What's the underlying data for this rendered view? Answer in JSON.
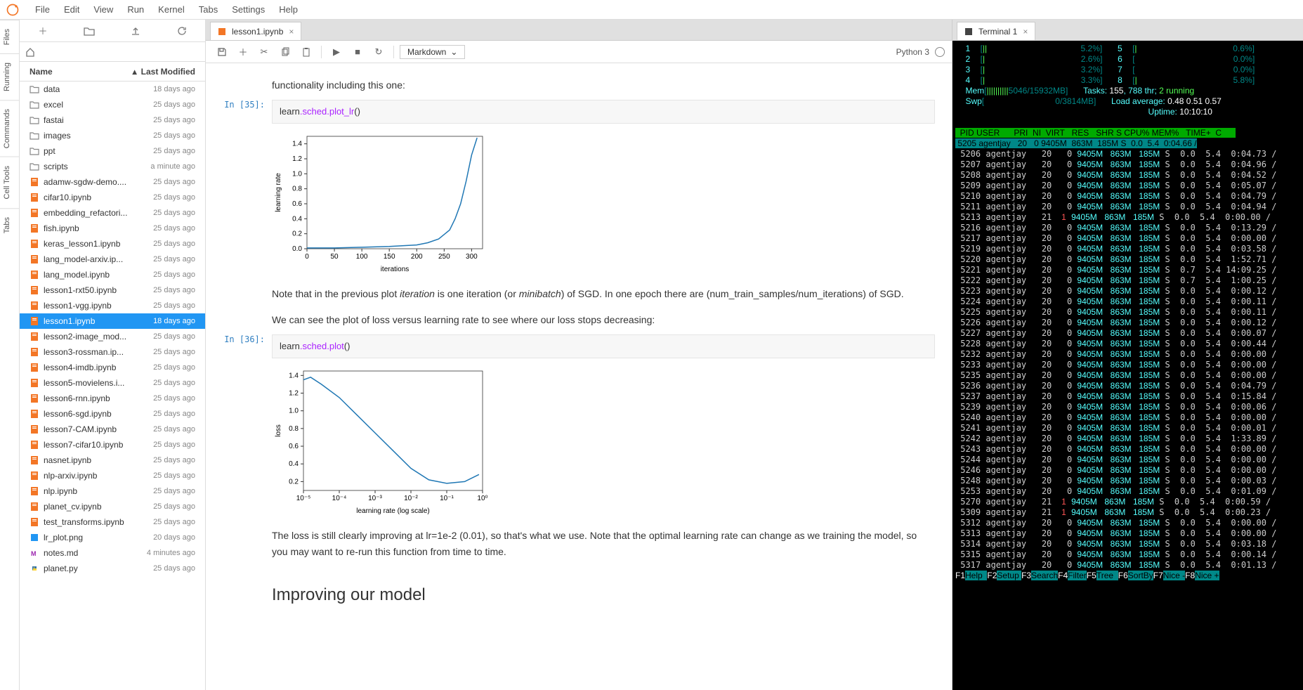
{
  "menubar": [
    "File",
    "Edit",
    "View",
    "Run",
    "Kernel",
    "Tabs",
    "Settings",
    "Help"
  ],
  "rail": [
    "Files",
    "Running",
    "Commands",
    "Cell Tools",
    "Tabs"
  ],
  "fileHeader": {
    "name": "Name",
    "modified": "Last Modified"
  },
  "files": [
    {
      "icon": "folder",
      "name": "data",
      "mod": "18 days ago"
    },
    {
      "icon": "folder",
      "name": "excel",
      "mod": "25 days ago"
    },
    {
      "icon": "folder",
      "name": "fastai",
      "mod": "25 days ago"
    },
    {
      "icon": "folder",
      "name": "images",
      "mod": "25 days ago"
    },
    {
      "icon": "folder",
      "name": "ppt",
      "mod": "25 days ago"
    },
    {
      "icon": "folder",
      "name": "scripts",
      "mod": "a minute ago"
    },
    {
      "icon": "nb",
      "name": "adamw-sgdw-demo....",
      "mod": "25 days ago"
    },
    {
      "icon": "nb",
      "name": "cifar10.ipynb",
      "mod": "25 days ago"
    },
    {
      "icon": "nb",
      "name": "embedding_refactori...",
      "mod": "25 days ago"
    },
    {
      "icon": "nb",
      "name": "fish.ipynb",
      "mod": "25 days ago"
    },
    {
      "icon": "nb",
      "name": "keras_lesson1.ipynb",
      "mod": "25 days ago"
    },
    {
      "icon": "nb",
      "name": "lang_model-arxiv.ip...",
      "mod": "25 days ago"
    },
    {
      "icon": "nb",
      "name": "lang_model.ipynb",
      "mod": "25 days ago"
    },
    {
      "icon": "nb",
      "name": "lesson1-rxt50.ipynb",
      "mod": "25 days ago"
    },
    {
      "icon": "nb",
      "name": "lesson1-vgg.ipynb",
      "mod": "25 days ago"
    },
    {
      "icon": "nb",
      "name": "lesson1.ipynb",
      "mod": "18 days ago",
      "selected": true
    },
    {
      "icon": "nb",
      "name": "lesson2-image_mod...",
      "mod": "25 days ago"
    },
    {
      "icon": "nb",
      "name": "lesson3-rossman.ip...",
      "mod": "25 days ago"
    },
    {
      "icon": "nb",
      "name": "lesson4-imdb.ipynb",
      "mod": "25 days ago"
    },
    {
      "icon": "nb",
      "name": "lesson5-movielens.i...",
      "mod": "25 days ago"
    },
    {
      "icon": "nb",
      "name": "lesson6-rnn.ipynb",
      "mod": "25 days ago"
    },
    {
      "icon": "nb",
      "name": "lesson6-sgd.ipynb",
      "mod": "25 days ago"
    },
    {
      "icon": "nb",
      "name": "lesson7-CAM.ipynb",
      "mod": "25 days ago"
    },
    {
      "icon": "nb",
      "name": "lesson7-cifar10.ipynb",
      "mod": "25 days ago"
    },
    {
      "icon": "nb",
      "name": "nasnet.ipynb",
      "mod": "25 days ago"
    },
    {
      "icon": "nb",
      "name": "nlp-arxiv.ipynb",
      "mod": "25 days ago"
    },
    {
      "icon": "nb",
      "name": "nlp.ipynb",
      "mod": "25 days ago"
    },
    {
      "icon": "nb",
      "name": "planet_cv.ipynb",
      "mod": "25 days ago"
    },
    {
      "icon": "nb",
      "name": "test_transforms.ipynb",
      "mod": "25 days ago"
    },
    {
      "icon": "img",
      "name": "lr_plot.png",
      "mod": "20 days ago"
    },
    {
      "icon": "md",
      "name": "notes.md",
      "mod": "4 minutes ago"
    },
    {
      "icon": "py",
      "name": "planet.py",
      "mod": "25 days ago"
    }
  ],
  "tab": {
    "title": "lesson1.ipynb"
  },
  "celltype": "Markdown",
  "kernel": "Python 3",
  "nb": {
    "md0": "functionality including this one:",
    "prompt1": "In [35]:",
    "code1a": "learn",
    "code1b": ".sched.plot_lr",
    "code1c": "()",
    "md1a": "Note that in the previous plot ",
    "md1_it1": "iteration",
    "md1b": " is one iteration (or ",
    "md1_it2": "minibatch",
    "md1c": ") of SGD. In one epoch there are (num_train_samples/num_iterations) of SGD.",
    "md2": "We can see the plot of loss versus learning rate to see where our loss stops decreasing:",
    "prompt2": "In [36]:",
    "code2a": "learn",
    "code2b": ".sched.plot",
    "code2c": "()",
    "md3": "The loss is still clearly improving at lr=1e-2 (0.01), so that's what we use. Note that the optimal learning rate can change as we training the model, so you may want to re-run this function from time to time.",
    "h2": "Improving our model"
  },
  "chart_data": [
    {
      "type": "line",
      "title": "",
      "xlabel": "iterations",
      "ylabel": "learning rate",
      "xlim": [
        0,
        320
      ],
      "ylim": [
        0,
        1.5
      ],
      "xticks": [
        0,
        50,
        100,
        150,
        200,
        250,
        300
      ],
      "yticks": [
        0.0,
        0.2,
        0.4,
        0.6,
        0.8,
        1.0,
        1.2,
        1.4
      ],
      "x": [
        0,
        50,
        100,
        150,
        200,
        220,
        240,
        260,
        270,
        280,
        290,
        300,
        310
      ],
      "values": [
        0.01,
        0.01,
        0.02,
        0.03,
        0.05,
        0.08,
        0.13,
        0.25,
        0.4,
        0.6,
        0.9,
        1.25,
        1.48
      ]
    },
    {
      "type": "line",
      "title": "",
      "xlabel": "learning rate (log scale)",
      "ylabel": "loss",
      "xlim_log": [
        -5,
        0
      ],
      "ylim": [
        0.1,
        1.45
      ],
      "xticks_labels": [
        "10⁻⁵",
        "10⁻⁴",
        "10⁻³",
        "10⁻²",
        "10⁻¹",
        "10⁰"
      ],
      "yticks": [
        0.2,
        0.4,
        0.6,
        0.8,
        1.0,
        1.2,
        1.4
      ],
      "x_log": [
        -5,
        -4.8,
        -4.5,
        -4,
        -3.5,
        -3,
        -2.5,
        -2,
        -1.5,
        -1,
        -0.5,
        -0.1
      ],
      "values": [
        1.35,
        1.38,
        1.3,
        1.15,
        0.95,
        0.75,
        0.55,
        0.35,
        0.22,
        0.18,
        0.2,
        0.28
      ]
    }
  ],
  "terminal": {
    "tab": "Terminal 1",
    "cpus": [
      {
        "n": "1",
        "bar": "||",
        "pct": "5.2%"
      },
      {
        "n": "2",
        "bar": "|",
        "pct": "2.6%"
      },
      {
        "n": "3",
        "bar": "|",
        "pct": "3.2%"
      },
      {
        "n": "4",
        "bar": "|",
        "pct": "3.3%"
      },
      {
        "n": "5",
        "bar": "|",
        "pct": "0.6%"
      },
      {
        "n": "6",
        "bar": "",
        "pct": "0.0%"
      },
      {
        "n": "7",
        "bar": "",
        "pct": "0.0%"
      },
      {
        "n": "8",
        "bar": "|",
        "pct": "5.8%"
      }
    ],
    "mem": {
      "label": "Mem",
      "used": "5046",
      "total": "15932MB"
    },
    "swp": {
      "label": "Swp",
      "used": "0",
      "total": "3814MB"
    },
    "tasks_label": "Tasks: ",
    "tasks": "155",
    "thr": ", 788 thr; ",
    "running": "2 running",
    "load_label": "Load average: ",
    "load": "0.48 0.51 0.57",
    "uptime_label": "Uptime: ",
    "uptime": "10:10:10",
    "header": "  PID USER      PRI  NI  VIRT   RES   SHR S CPU% MEM%   TIME+  C",
    "procs": [
      {
        "pid": "5205",
        "user": "agentjay",
        "pri": "20",
        "ni": "0",
        "virt": "9405M",
        "res": "863M",
        "shr": "185M",
        "s": "S",
        "cpu": "0.0",
        "mem": "5.4",
        "time": "0:04.66",
        "hl": true
      },
      {
        "pid": "5206",
        "user": "agentjay",
        "pri": "20",
        "ni": "0",
        "virt": "9405M",
        "res": "863M",
        "shr": "185M",
        "s": "S",
        "cpu": "0.0",
        "mem": "5.4",
        "time": "0:04.73"
      },
      {
        "pid": "5207",
        "user": "agentjay",
        "pri": "20",
        "ni": "0",
        "virt": "9405M",
        "res": "863M",
        "shr": "185M",
        "s": "S",
        "cpu": "0.0",
        "mem": "5.4",
        "time": "0:04.96"
      },
      {
        "pid": "5208",
        "user": "agentjay",
        "pri": "20",
        "ni": "0",
        "virt": "9405M",
        "res": "863M",
        "shr": "185M",
        "s": "S",
        "cpu": "0.0",
        "mem": "5.4",
        "time": "0:04.52"
      },
      {
        "pid": "5209",
        "user": "agentjay",
        "pri": "20",
        "ni": "0",
        "virt": "9405M",
        "res": "863M",
        "shr": "185M",
        "s": "S",
        "cpu": "0.0",
        "mem": "5.4",
        "time": "0:05.07"
      },
      {
        "pid": "5210",
        "user": "agentjay",
        "pri": "20",
        "ni": "0",
        "virt": "9405M",
        "res": "863M",
        "shr": "185M",
        "s": "S",
        "cpu": "0.0",
        "mem": "5.4",
        "time": "0:04.79"
      },
      {
        "pid": "5211",
        "user": "agentjay",
        "pri": "20",
        "ni": "0",
        "virt": "9405M",
        "res": "863M",
        "shr": "185M",
        "s": "S",
        "cpu": "0.0",
        "mem": "5.4",
        "time": "0:04.94"
      },
      {
        "pid": "5213",
        "user": "agentjay",
        "pri": "21",
        "ni": "1",
        "virt": "9405M",
        "res": "863M",
        "shr": "185M",
        "s": "S",
        "cpu": "0.0",
        "mem": "5.4",
        "time": "0:00.00",
        "ni_red": true
      },
      {
        "pid": "5216",
        "user": "agentjay",
        "pri": "20",
        "ni": "0",
        "virt": "9405M",
        "res": "863M",
        "shr": "185M",
        "s": "S",
        "cpu": "0.0",
        "mem": "5.4",
        "time": "0:13.29"
      },
      {
        "pid": "5217",
        "user": "agentjay",
        "pri": "20",
        "ni": "0",
        "virt": "9405M",
        "res": "863M",
        "shr": "185M",
        "s": "S",
        "cpu": "0.0",
        "mem": "5.4",
        "time": "0:00.00"
      },
      {
        "pid": "5219",
        "user": "agentjay",
        "pri": "20",
        "ni": "0",
        "virt": "9405M",
        "res": "863M",
        "shr": "185M",
        "s": "S",
        "cpu": "0.0",
        "mem": "5.4",
        "time": "0:03.58"
      },
      {
        "pid": "5220",
        "user": "agentjay",
        "pri": "20",
        "ni": "0",
        "virt": "9405M",
        "res": "863M",
        "shr": "185M",
        "s": "S",
        "cpu": "0.0",
        "mem": "5.4",
        "time": "1:52.71"
      },
      {
        "pid": "5221",
        "user": "agentjay",
        "pri": "20",
        "ni": "0",
        "virt": "9405M",
        "res": "863M",
        "shr": "185M",
        "s": "S",
        "cpu": "0.7",
        "mem": "5.4",
        "time": "14:09.25"
      },
      {
        "pid": "5222",
        "user": "agentjay",
        "pri": "20",
        "ni": "0",
        "virt": "9405M",
        "res": "863M",
        "shr": "185M",
        "s": "S",
        "cpu": "0.7",
        "mem": "5.4",
        "time": "1:00.25"
      },
      {
        "pid": "5223",
        "user": "agentjay",
        "pri": "20",
        "ni": "0",
        "virt": "9405M",
        "res": "863M",
        "shr": "185M",
        "s": "S",
        "cpu": "0.0",
        "mem": "5.4",
        "time": "0:00.12"
      },
      {
        "pid": "5224",
        "user": "agentjay",
        "pri": "20",
        "ni": "0",
        "virt": "9405M",
        "res": "863M",
        "shr": "185M",
        "s": "S",
        "cpu": "0.0",
        "mem": "5.4",
        "time": "0:00.11"
      },
      {
        "pid": "5225",
        "user": "agentjay",
        "pri": "20",
        "ni": "0",
        "virt": "9405M",
        "res": "863M",
        "shr": "185M",
        "s": "S",
        "cpu": "0.0",
        "mem": "5.4",
        "time": "0:00.11"
      },
      {
        "pid": "5226",
        "user": "agentjay",
        "pri": "20",
        "ni": "0",
        "virt": "9405M",
        "res": "863M",
        "shr": "185M",
        "s": "S",
        "cpu": "0.0",
        "mem": "5.4",
        "time": "0:00.12"
      },
      {
        "pid": "5227",
        "user": "agentjay",
        "pri": "20",
        "ni": "0",
        "virt": "9405M",
        "res": "863M",
        "shr": "185M",
        "s": "S",
        "cpu": "0.0",
        "mem": "5.4",
        "time": "0:00.07"
      },
      {
        "pid": "5228",
        "user": "agentjay",
        "pri": "20",
        "ni": "0",
        "virt": "9405M",
        "res": "863M",
        "shr": "185M",
        "s": "S",
        "cpu": "0.0",
        "mem": "5.4",
        "time": "0:00.44"
      },
      {
        "pid": "5232",
        "user": "agentjay",
        "pri": "20",
        "ni": "0",
        "virt": "9405M",
        "res": "863M",
        "shr": "185M",
        "s": "S",
        "cpu": "0.0",
        "mem": "5.4",
        "time": "0:00.00"
      },
      {
        "pid": "5233",
        "user": "agentjay",
        "pri": "20",
        "ni": "0",
        "virt": "9405M",
        "res": "863M",
        "shr": "185M",
        "s": "S",
        "cpu": "0.0",
        "mem": "5.4",
        "time": "0:00.00"
      },
      {
        "pid": "5235",
        "user": "agentjay",
        "pri": "20",
        "ni": "0",
        "virt": "9405M",
        "res": "863M",
        "shr": "185M",
        "s": "S",
        "cpu": "0.0",
        "mem": "5.4",
        "time": "0:00.00"
      },
      {
        "pid": "5236",
        "user": "agentjay",
        "pri": "20",
        "ni": "0",
        "virt": "9405M",
        "res": "863M",
        "shr": "185M",
        "s": "S",
        "cpu": "0.0",
        "mem": "5.4",
        "time": "0:04.79"
      },
      {
        "pid": "5237",
        "user": "agentjay",
        "pri": "20",
        "ni": "0",
        "virt": "9405M",
        "res": "863M",
        "shr": "185M",
        "s": "S",
        "cpu": "0.0",
        "mem": "5.4",
        "time": "0:15.84"
      },
      {
        "pid": "5239",
        "user": "agentjay",
        "pri": "20",
        "ni": "0",
        "virt": "9405M",
        "res": "863M",
        "shr": "185M",
        "s": "S",
        "cpu": "0.0",
        "mem": "5.4",
        "time": "0:00.06"
      },
      {
        "pid": "5240",
        "user": "agentjay",
        "pri": "20",
        "ni": "0",
        "virt": "9405M",
        "res": "863M",
        "shr": "185M",
        "s": "S",
        "cpu": "0.0",
        "mem": "5.4",
        "time": "0:00.00"
      },
      {
        "pid": "5241",
        "user": "agentjay",
        "pri": "20",
        "ni": "0",
        "virt": "9405M",
        "res": "863M",
        "shr": "185M",
        "s": "S",
        "cpu": "0.0",
        "mem": "5.4",
        "time": "0:00.01"
      },
      {
        "pid": "5242",
        "user": "agentjay",
        "pri": "20",
        "ni": "0",
        "virt": "9405M",
        "res": "863M",
        "shr": "185M",
        "s": "S",
        "cpu": "0.0",
        "mem": "5.4",
        "time": "1:33.89"
      },
      {
        "pid": "5243",
        "user": "agentjay",
        "pri": "20",
        "ni": "0",
        "virt": "9405M",
        "res": "863M",
        "shr": "185M",
        "s": "S",
        "cpu": "0.0",
        "mem": "5.4",
        "time": "0:00.00"
      },
      {
        "pid": "5244",
        "user": "agentjay",
        "pri": "20",
        "ni": "0",
        "virt": "9405M",
        "res": "863M",
        "shr": "185M",
        "s": "S",
        "cpu": "0.0",
        "mem": "5.4",
        "time": "0:00.00"
      },
      {
        "pid": "5246",
        "user": "agentjay",
        "pri": "20",
        "ni": "0",
        "virt": "9405M",
        "res": "863M",
        "shr": "185M",
        "s": "S",
        "cpu": "0.0",
        "mem": "5.4",
        "time": "0:00.00"
      },
      {
        "pid": "5248",
        "user": "agentjay",
        "pri": "20",
        "ni": "0",
        "virt": "9405M",
        "res": "863M",
        "shr": "185M",
        "s": "S",
        "cpu": "0.0",
        "mem": "5.4",
        "time": "0:00.03"
      },
      {
        "pid": "5253",
        "user": "agentjay",
        "pri": "20",
        "ni": "0",
        "virt": "9405M",
        "res": "863M",
        "shr": "185M",
        "s": "S",
        "cpu": "0.0",
        "mem": "5.4",
        "time": "0:01.09"
      },
      {
        "pid": "5270",
        "user": "agentjay",
        "pri": "21",
        "ni": "1",
        "virt": "9405M",
        "res": "863M",
        "shr": "185M",
        "s": "S",
        "cpu": "0.0",
        "mem": "5.4",
        "time": "0:00.59",
        "ni_red": true
      },
      {
        "pid": "5309",
        "user": "agentjay",
        "pri": "21",
        "ni": "1",
        "virt": "9405M",
        "res": "863M",
        "shr": "185M",
        "s": "S",
        "cpu": "0.0",
        "mem": "5.4",
        "time": "0:00.23",
        "ni_red": true
      },
      {
        "pid": "5312",
        "user": "agentjay",
        "pri": "20",
        "ni": "0",
        "virt": "9405M",
        "res": "863M",
        "shr": "185M",
        "s": "S",
        "cpu": "0.0",
        "mem": "5.4",
        "time": "0:00.00"
      },
      {
        "pid": "5313",
        "user": "agentjay",
        "pri": "20",
        "ni": "0",
        "virt": "9405M",
        "res": "863M",
        "shr": "185M",
        "s": "S",
        "cpu": "0.0",
        "mem": "5.4",
        "time": "0:00.00"
      },
      {
        "pid": "5314",
        "user": "agentjay",
        "pri": "20",
        "ni": "0",
        "virt": "9405M",
        "res": "863M",
        "shr": "185M",
        "s": "S",
        "cpu": "0.0",
        "mem": "5.4",
        "time": "0:03.18"
      },
      {
        "pid": "5315",
        "user": "agentjay",
        "pri": "20",
        "ni": "0",
        "virt": "9405M",
        "res": "863M",
        "shr": "185M",
        "s": "S",
        "cpu": "0.0",
        "mem": "5.4",
        "time": "0:00.14"
      },
      {
        "pid": "5317",
        "user": "agentjay",
        "pri": "20",
        "ni": "0",
        "virt": "9405M",
        "res": "863M",
        "shr": "185M",
        "s": "S",
        "cpu": "0.0",
        "mem": "5.4",
        "time": "0:01.13"
      }
    ],
    "fkeys": [
      {
        "k": "F1",
        "l": "Help"
      },
      {
        "k": "F2",
        "l": "Setup"
      },
      {
        "k": "F3",
        "l": "Search"
      },
      {
        "k": "F4",
        "l": "Filter"
      },
      {
        "k": "F5",
        "l": "Tree"
      },
      {
        "k": "F6",
        "l": "SortBy"
      },
      {
        "k": "F7",
        "l": "Nice -"
      },
      {
        "k": "F8",
        "l": "Nice +"
      }
    ]
  }
}
